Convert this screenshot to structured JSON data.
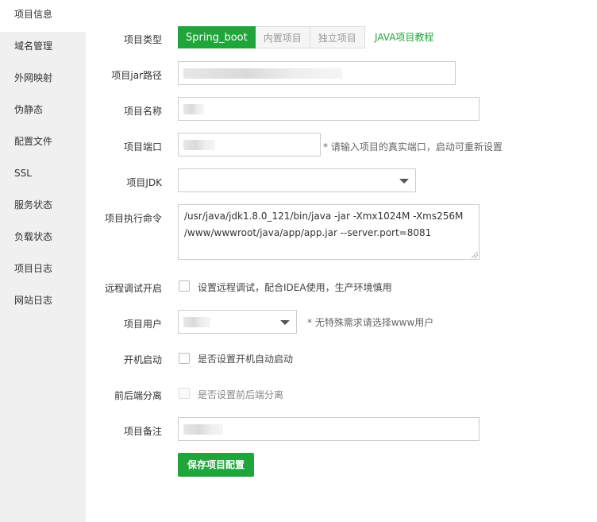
{
  "sidebar": {
    "items": [
      {
        "label": "项目信息"
      },
      {
        "label": "域名管理"
      },
      {
        "label": "外网映射"
      },
      {
        "label": "伪静态"
      },
      {
        "label": "配置文件"
      },
      {
        "label": "SSL"
      },
      {
        "label": "服务状态"
      },
      {
        "label": "负载状态"
      },
      {
        "label": "项目日志"
      },
      {
        "label": "网站日志"
      }
    ]
  },
  "form": {
    "project_type": {
      "label": "项目类型",
      "options": [
        "Spring_boot",
        "内置项目",
        "独立项目"
      ],
      "selected": "Spring_boot",
      "tutorial_link": "JAVA项目教程"
    },
    "jar_path": {
      "label": "项目jar路径",
      "value": ""
    },
    "project_name": {
      "label": "项目名称",
      "value": ""
    },
    "project_port": {
      "label": "项目端口",
      "value": "",
      "hint": "* 请输入项目的真实端口，启动可重新设置"
    },
    "project_jdk": {
      "label": "项目JDK",
      "value": ""
    },
    "exec_command": {
      "label": "项目执行命令",
      "value": "/usr/java/jdk1.8.0_121/bin/java -jar -Xmx1024M -Xms256M\n/www/wwwroot/java/app/app.jar --server.port=8081"
    },
    "remote_debug": {
      "label": "远程调试开启",
      "text": "设置远程调试，配合IDEA使用，生产环境慎用",
      "checked": false
    },
    "project_user": {
      "label": "项目用户",
      "value": "",
      "hint": "* 无特殊需求请选择www用户"
    },
    "boot_start": {
      "label": "开机启动",
      "text": "是否设置开机自动启动",
      "checked": false
    },
    "separation": {
      "label": "前后端分离",
      "text": "是否设置前后端分离",
      "checked": false,
      "disabled": true
    },
    "remark": {
      "label": "项目备注",
      "value": ""
    },
    "save_label": "保存项目配置"
  },
  "colors": {
    "accent": "#20a53a",
    "sidebar_bg": "#f0f0f0"
  }
}
